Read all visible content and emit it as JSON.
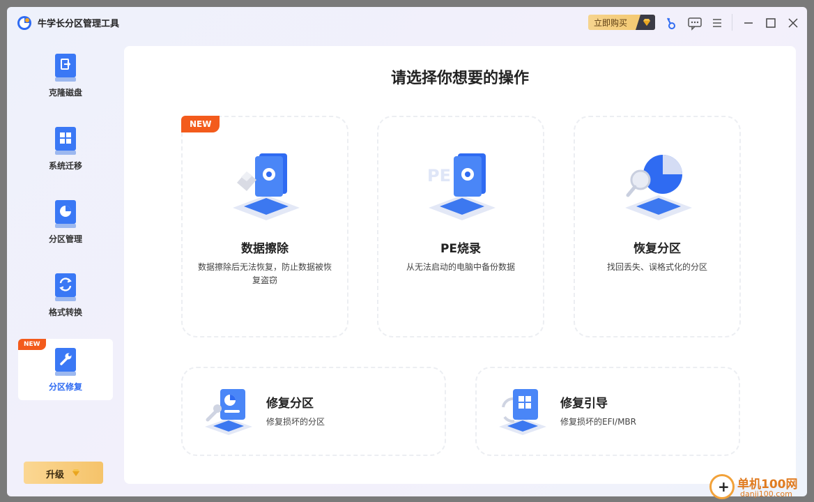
{
  "app": {
    "title": "牛学长分区管理工具",
    "logo_icon": "app-logo-icon"
  },
  "titlebar": {
    "buy_label": "立即购买",
    "icons": [
      "key-icon",
      "feedback-icon",
      "menu-icon",
      "minimize-icon",
      "maximize-icon",
      "close-icon"
    ]
  },
  "sidebar": {
    "items": [
      {
        "label": "克隆磁盘",
        "icon": "clone-disk-icon"
      },
      {
        "label": "系统迁移",
        "icon": "system-migrate-icon"
      },
      {
        "label": "分区管理",
        "icon": "partition-manage-icon"
      },
      {
        "label": "格式转换",
        "icon": "format-convert-icon"
      },
      {
        "label": "分区修复",
        "icon": "partition-repair-icon",
        "badge": "NEW",
        "active": true
      }
    ],
    "upgrade_label": "升级"
  },
  "main": {
    "title": "请选择你想要的操作",
    "cards": [
      {
        "title": "数据擦除",
        "desc": "数据擦除后无法恢复，防止数据被恢复盗窃",
        "badge": "NEW",
        "icon": "data-erase-icon"
      },
      {
        "title": "PE烧录",
        "desc": "从无法启动的电脑中备份数据",
        "icon": "pe-burn-icon"
      },
      {
        "title": "恢复分区",
        "desc": "找回丢失、误格式化的分区",
        "icon": "recover-partition-icon"
      },
      {
        "title": "修复分区",
        "desc": "修复损坏的分区",
        "icon": "repair-partition-icon"
      },
      {
        "title": "修复引导",
        "desc": "修复损坏的EFI/MBR",
        "icon": "repair-boot-icon"
      }
    ]
  },
  "watermark": {
    "text": "单机100网",
    "url": "danji100.com"
  },
  "colors": {
    "accent": "#2f6bf2",
    "new_badge": "#f35b1c",
    "gold": "#f5c36a"
  }
}
